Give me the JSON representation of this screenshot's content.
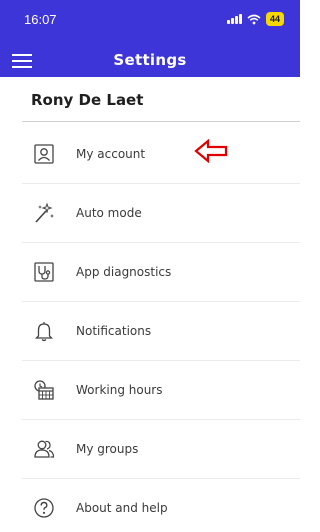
{
  "status_bar": {
    "time": "16:07",
    "battery": "44"
  },
  "header": {
    "title": "Settings"
  },
  "profile": {
    "name": "Rony De Laet"
  },
  "menu": [
    {
      "label": "My account",
      "icon": "account-card-icon"
    },
    {
      "label": "Auto mode",
      "icon": "magic-wand-icon"
    },
    {
      "label": "App diagnostics",
      "icon": "stethoscope-icon"
    },
    {
      "label": "Notifications",
      "icon": "bell-icon"
    },
    {
      "label": "Working hours",
      "icon": "calendar-clock-icon"
    },
    {
      "label": "My groups",
      "icon": "groups-icon"
    },
    {
      "label": "About and help",
      "icon": "help-circle-icon"
    }
  ],
  "annotation": {
    "color": "#e00000",
    "points_to": "My account"
  },
  "colors": {
    "header_bg": "#3d35d7",
    "battery": "#f5d800"
  }
}
